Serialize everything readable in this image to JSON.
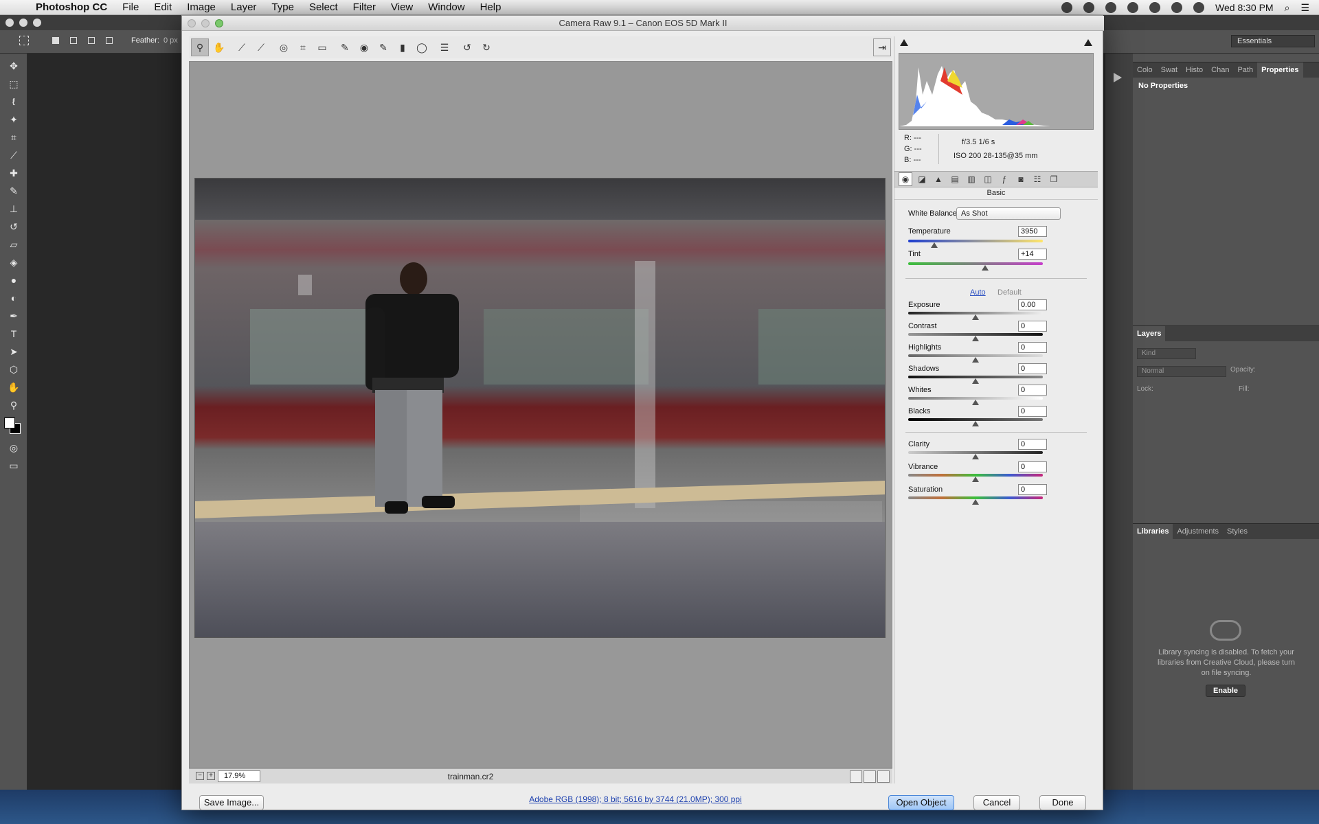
{
  "menubar": {
    "app_name": "Photoshop CC",
    "items": [
      "File",
      "Edit",
      "Image",
      "Layer",
      "Type",
      "Select",
      "Filter",
      "View",
      "Window",
      "Help"
    ],
    "clock": "Wed 8:30 PM"
  },
  "ps": {
    "feather_label": "Feather:",
    "feather_value": "0 px",
    "workspace": "Essentials",
    "panel_tabs": [
      "Colo",
      "Swat",
      "Histo",
      "Chan",
      "Path",
      "Properties"
    ],
    "properties_text": "No Properties",
    "layers_title": "Layers",
    "layers_kind": "Kind",
    "blend_mode": "Normal",
    "opacity_label": "Opacity:",
    "lock_label": "Lock:",
    "fill_label": "Fill:",
    "lib_tabs": [
      "Libraries",
      "Adjustments",
      "Styles"
    ],
    "lib_message": "Library syncing is disabled. To fetch your libraries from Creative Cloud, please turn on file syncing.",
    "enable_label": "Enable"
  },
  "dialog": {
    "title": "Camera Raw 9.1  –  Canon EOS 5D Mark II",
    "zoom": "17.9%",
    "filename": "trainman.cr2",
    "save_label": "Save Image...",
    "workflow_link": "Adobe RGB (1998); 8 bit; 5616 by 3744 (21.0MP); 300 ppi",
    "open_label": "Open Object",
    "cancel_label": "Cancel",
    "done_label": "Done"
  },
  "meta": {
    "r": "R:  ---",
    "g": "G:  ---",
    "b": "B:  ---",
    "aperture_shutter": "f/3.5    1/6 s",
    "iso_lens": "ISO 200    28-135@35 mm"
  },
  "basic": {
    "header": "Basic",
    "wb_label": "White Balance:",
    "wb_value": "As Shot",
    "auto": "Auto",
    "default": "Default",
    "controls": [
      {
        "label": "Temperature",
        "value": "3950"
      },
      {
        "label": "Tint",
        "value": "+14"
      },
      {
        "label": "Exposure",
        "value": "0.00"
      },
      {
        "label": "Contrast",
        "value": "0"
      },
      {
        "label": "Highlights",
        "value": "0"
      },
      {
        "label": "Shadows",
        "value": "0"
      },
      {
        "label": "Whites",
        "value": "0"
      },
      {
        "label": "Blacks",
        "value": "0"
      },
      {
        "label": "Clarity",
        "value": "0"
      },
      {
        "label": "Vibrance",
        "value": "0"
      },
      {
        "label": "Saturation",
        "value": "0"
      }
    ]
  }
}
